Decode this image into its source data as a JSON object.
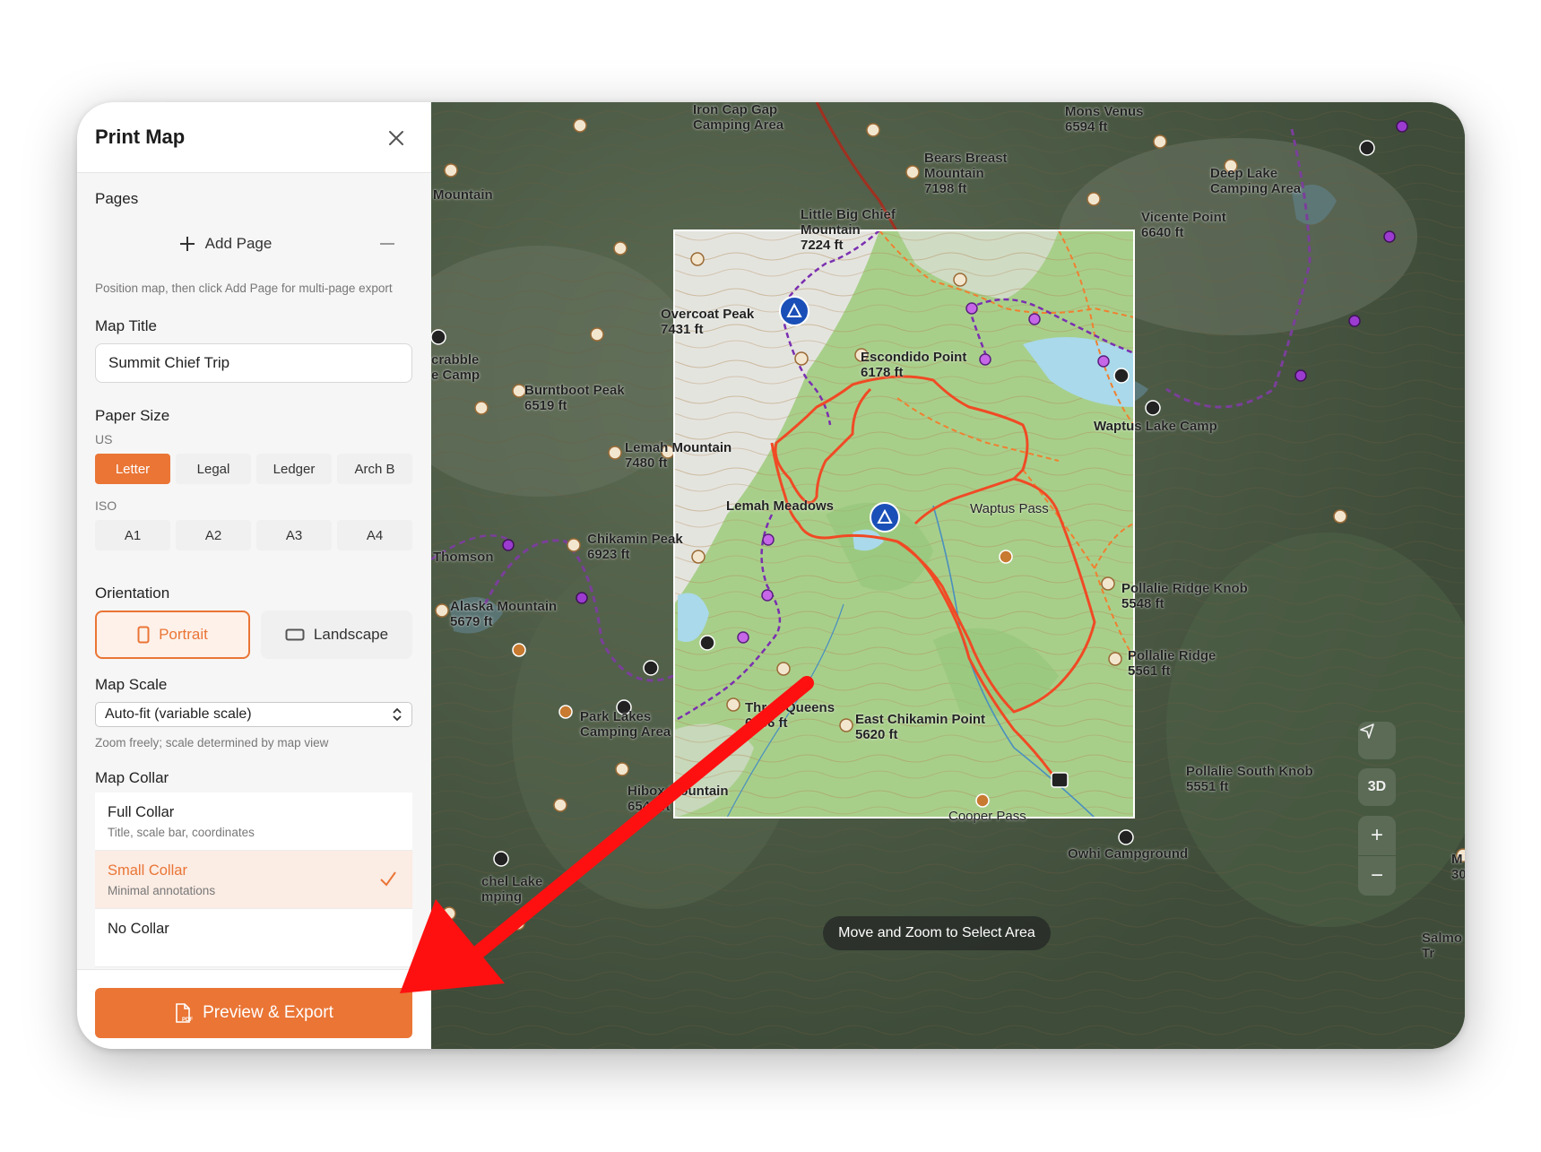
{
  "panel": {
    "title": "Print Map",
    "pages": {
      "label": "Pages",
      "add_label": "Add Page",
      "hint": "Position map, then click Add Page for multi-page export"
    },
    "map_title": {
      "label": "Map Title",
      "value": "Summit Chief Trip"
    },
    "paper_size": {
      "label": "Paper Size",
      "us_label": "US",
      "us_options": [
        "Letter",
        "Legal",
        "Ledger",
        "Arch B"
      ],
      "selected": "Letter",
      "iso_label": "ISO",
      "iso_options": [
        "A1",
        "A2",
        "A3",
        "A4"
      ]
    },
    "orientation": {
      "label": "Orientation",
      "options": [
        "Portrait",
        "Landscape"
      ],
      "selected": "Portrait"
    },
    "map_scale": {
      "label": "Map Scale",
      "value": "Auto-fit (variable scale)",
      "hint": "Zoom freely; scale determined by map view"
    },
    "map_collar": {
      "label": "Map Collar",
      "options": [
        {
          "name": "Full Collar",
          "desc": "Title, scale bar, coordinates"
        },
        {
          "name": "Small Collar",
          "desc": "Minimal annotations"
        },
        {
          "name": "No Collar",
          "desc": ""
        }
      ],
      "selected": "Small Collar"
    },
    "export_label": "Preview & Export",
    "pdf_badge": "PDF"
  },
  "map": {
    "labels": {
      "iron_cap": "Iron Cap Gap\nCamping Area",
      "mons_venus": "Mons Venus\n6594 ft",
      "bears_breast": "Bears Breast\nMountain\n7198 ft",
      "deep_lake": "Deep Lake\nCamping Area",
      "vicente": "Vicente Point\n6640 ft",
      "little_big_chief": "Little Big Chief\nMountain\n7224 ft",
      "mountain_left": "Mountain",
      "overcoat": "Overcoat Peak\n7431 ft",
      "escondido": "Escondido Point\n6178 ft",
      "scrabble": "crabble\ne Camp",
      "burntboot": "Burntboot Peak\n6519 ft",
      "waptus_lake": "Waptus Lake Camp",
      "lemah_mtn": "Lemah Mountain\n7480 ft",
      "waptus_pass": "Waptus Pass",
      "lemah_meadows": "Lemah Meadows",
      "chikamin": "Chikamin Peak\n6923 ft",
      "thomson": "Thomson",
      "pollalie_knob": "Pollalie Ridge Knob\n5548 ft",
      "alaska": "Alaska Mountain\n5679 ft",
      "pollalie_ridge": "Pollalie Ridge\n5561 ft",
      "three_queens": "Three Queens\n6686 ft",
      "east_chikamin": "East Chikamin Point\n5620 ft",
      "park_lakes": "Park Lakes\nCamping Area",
      "pollalie_south": "Pollalie South Knob\n5551 ft",
      "hibox": "Hibox Mountain\n6549 ft",
      "cooper_pass": "Cooper Pass",
      "owhi": "Owhi Campground",
      "rachel": "chel Lake\nmping",
      "salmo": "Salmo\nTr",
      "m30": "M\n30"
    },
    "toast": "Move and Zoom to Select Area",
    "controls": {
      "three_d": "3D",
      "zoom_in": "+",
      "zoom_out": "−"
    }
  }
}
